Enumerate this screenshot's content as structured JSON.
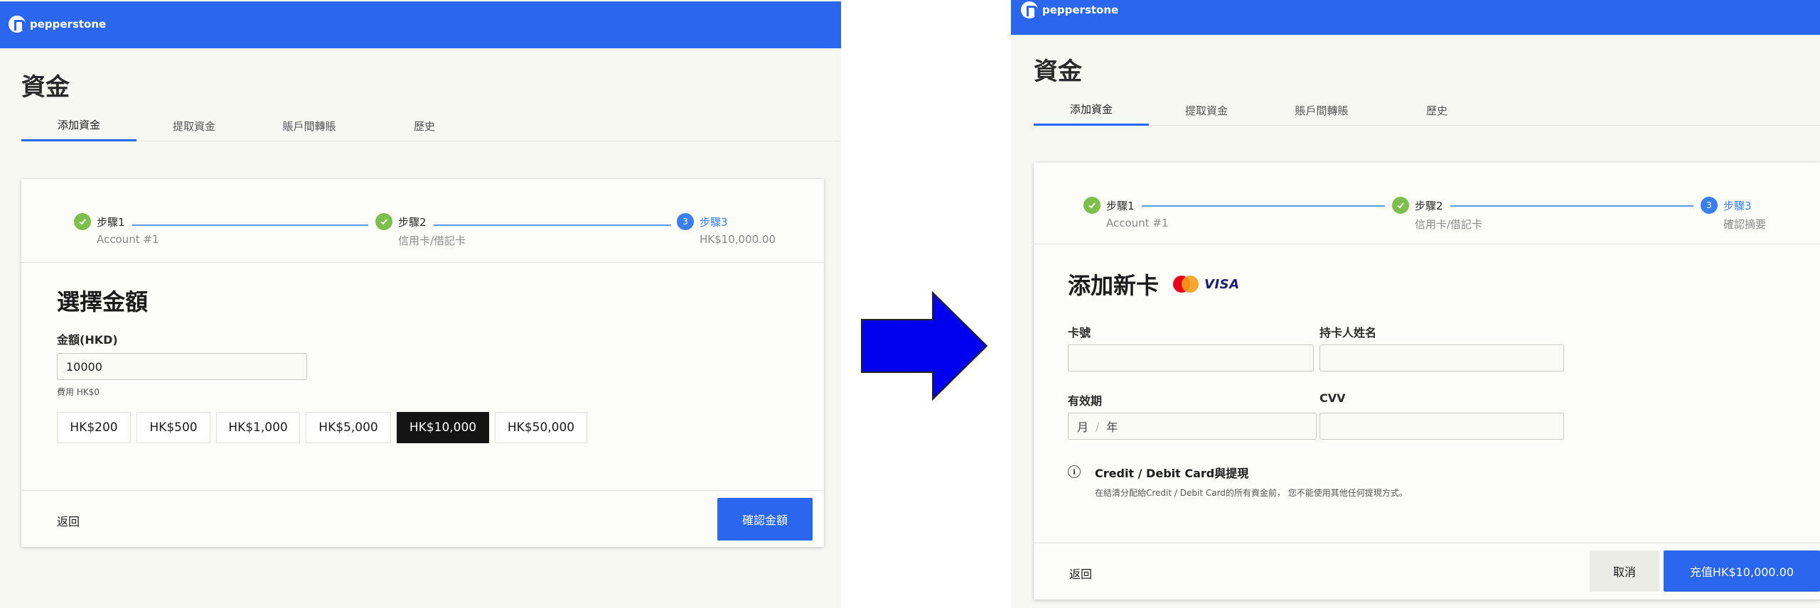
{
  "brand": "pepperstone",
  "page_title": "資金",
  "tabs": [
    "添加資金",
    "提取資金",
    "賬戶間轉賬",
    "歷史"
  ],
  "left": {
    "steps": [
      {
        "label": "步驟1",
        "sub": "Account #1"
      },
      {
        "label": "步驟2",
        "sub": "信用卡/借記卡"
      },
      {
        "label": "步驟3",
        "sub": "HK$10,000.00",
        "number": "3"
      }
    ],
    "section_title": "選擇金額",
    "amount_label": "金額(HKD)",
    "amount_value": "10000",
    "fee_text": "費用 HK$0",
    "presets": [
      "HK$200",
      "HK$500",
      "HK$1,000",
      "HK$5,000",
      "HK$10,000",
      "HK$50,000"
    ],
    "selected_preset": "HK$10,000",
    "back_label": "返回",
    "confirm_label": "確認金額"
  },
  "right": {
    "steps": [
      {
        "label": "步驟1",
        "sub": "Account #1"
      },
      {
        "label": "步驟2",
        "sub": "信用卡/借記卡"
      },
      {
        "label": "步驟3",
        "sub": "確認摘要",
        "number": "3"
      }
    ],
    "section_title": "添加新卡",
    "visa_text": "VISA",
    "card_number_label": "卡號",
    "card_holder_label": "持卡人姓名",
    "expiry_label": "有效期",
    "cvv_label": "CVV",
    "expiry_month_placeholder": "月",
    "expiry_separator": "/",
    "expiry_year_placeholder": "年",
    "info_icon": "i",
    "info_title": "Credit / Debit Card與提現",
    "info_desc": "在結清分配給Credit / Debit Card的所有資金前， 您不能使用其他任何提現方式。",
    "back_label": "返回",
    "cancel_label": "取消",
    "submit_label": "充值HK$10,000.00"
  },
  "icons": {
    "check": "check-icon",
    "arrow": "right-arrow-icon",
    "info": "info-icon",
    "mastercard": "mastercard-icon",
    "visa": "visa-icon"
  },
  "colors": {
    "brand_blue": "#2b66ef",
    "step_done": "#7cbf4c",
    "step_current": "#3a7ff0",
    "arrow_fill": "#0000ee"
  }
}
